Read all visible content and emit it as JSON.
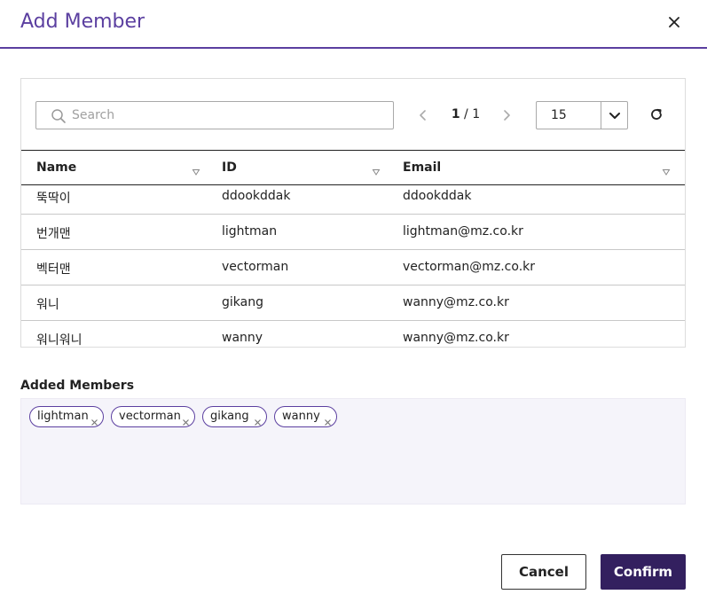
{
  "dialog": {
    "title": "Add Member"
  },
  "icons": {
    "close": "close-icon",
    "search": "search-icon",
    "prev": "chevron-left-icon",
    "next": "chevron-right-icon",
    "dropdown": "chevron-down-icon",
    "refresh": "refresh-icon",
    "sort": "sort-triangle-icon",
    "remove": "close-icon"
  },
  "search": {
    "placeholder": "Search",
    "value": ""
  },
  "pagination": {
    "current": "1",
    "separator": " / ",
    "total": "1"
  },
  "page_size": {
    "value": "15"
  },
  "table": {
    "columns": [
      "Name",
      "ID",
      "Email"
    ],
    "rows": [
      {
        "name": "뚝딱이",
        "id": "ddookddak",
        "email": "ddookddak"
      },
      {
        "name": "번개맨",
        "id": "lightman",
        "email": "lightman@mz.co.kr"
      },
      {
        "name": "벡터맨",
        "id": "vectorman",
        "email": "vectorman@mz.co.kr"
      },
      {
        "name": "워니",
        "id": "gikang",
        "email": "wanny@mz.co.kr"
      },
      {
        "name": "워니워니",
        "id": "wanny",
        "email": "wanny@mz.co.kr"
      }
    ]
  },
  "added_members": {
    "label": "Added Members",
    "tags": [
      "lightman",
      "vectorman",
      "gikang",
      "wanny"
    ]
  },
  "actions": {
    "cancel": "Cancel",
    "confirm": "Confirm"
  },
  "colors": {
    "accent": "#5b3fa0",
    "primary_button": "#33205f",
    "added_bg": "#f5f4fa",
    "header_border": "#5b3fa0"
  }
}
